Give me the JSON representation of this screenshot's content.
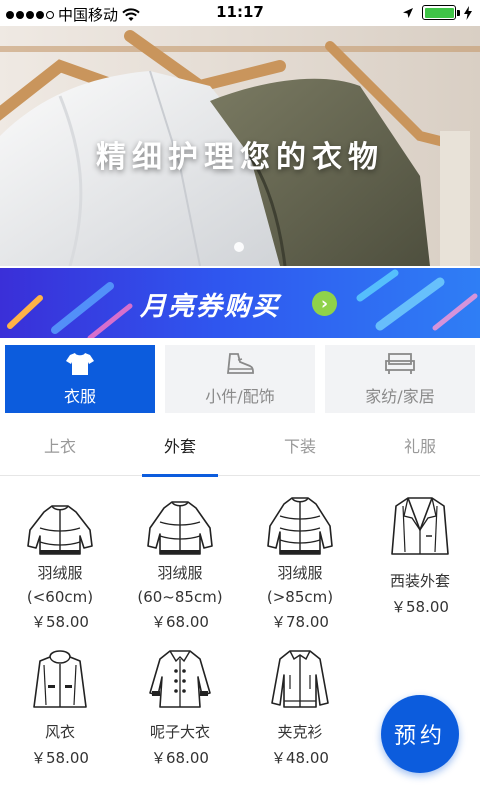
{
  "status_bar": {
    "carrier": "中国移动",
    "time": "11:17"
  },
  "hero": {
    "title": "精细护理您的衣物"
  },
  "banner": {
    "text": "月亮券购买",
    "go_icon": "chevron-right-icon"
  },
  "categories": [
    {
      "label": "衣服",
      "icon": "tshirt-icon",
      "active": true
    },
    {
      "label": "小件/配饰",
      "icon": "shoe-icon",
      "active": false
    },
    {
      "label": "家纺/家居",
      "icon": "sofa-icon",
      "active": false
    }
  ],
  "tabs": [
    {
      "label": "上衣",
      "active": false
    },
    {
      "label": "外套",
      "active": true
    },
    {
      "label": "下装",
      "active": false
    },
    {
      "label": "礼服",
      "active": false
    }
  ],
  "items": [
    {
      "name_line1": "羽绒服",
      "name_line2": "(<60cm)",
      "price": "￥58.00",
      "icon": "down-jacket-short-icon"
    },
    {
      "name_line1": "羽绒服",
      "name_line2": "(60~85cm)",
      "price": "￥68.00",
      "icon": "down-jacket-medium-icon"
    },
    {
      "name_line1": "羽绒服",
      "name_line2": "(>85cm)",
      "price": "￥78.00",
      "icon": "down-jacket-long-icon"
    },
    {
      "name_line1": "西装外套",
      "name_line2": "",
      "price": "￥58.00",
      "icon": "suit-jacket-icon"
    },
    {
      "name_line1": "风衣",
      "name_line2": "",
      "price": "￥58.00",
      "icon": "hooded-windbreaker-icon"
    },
    {
      "name_line1": "呢子大衣",
      "name_line2": "",
      "price": "￥68.00",
      "icon": "wool-coat-icon"
    },
    {
      "name_line1": "夹克衫",
      "name_line2": "",
      "price": "￥48.00",
      "icon": "jacket-icon"
    }
  ],
  "fab": {
    "label": "预约"
  },
  "colors": {
    "accent": "#0c5cdd",
    "banner_go": "#8fd24a"
  }
}
